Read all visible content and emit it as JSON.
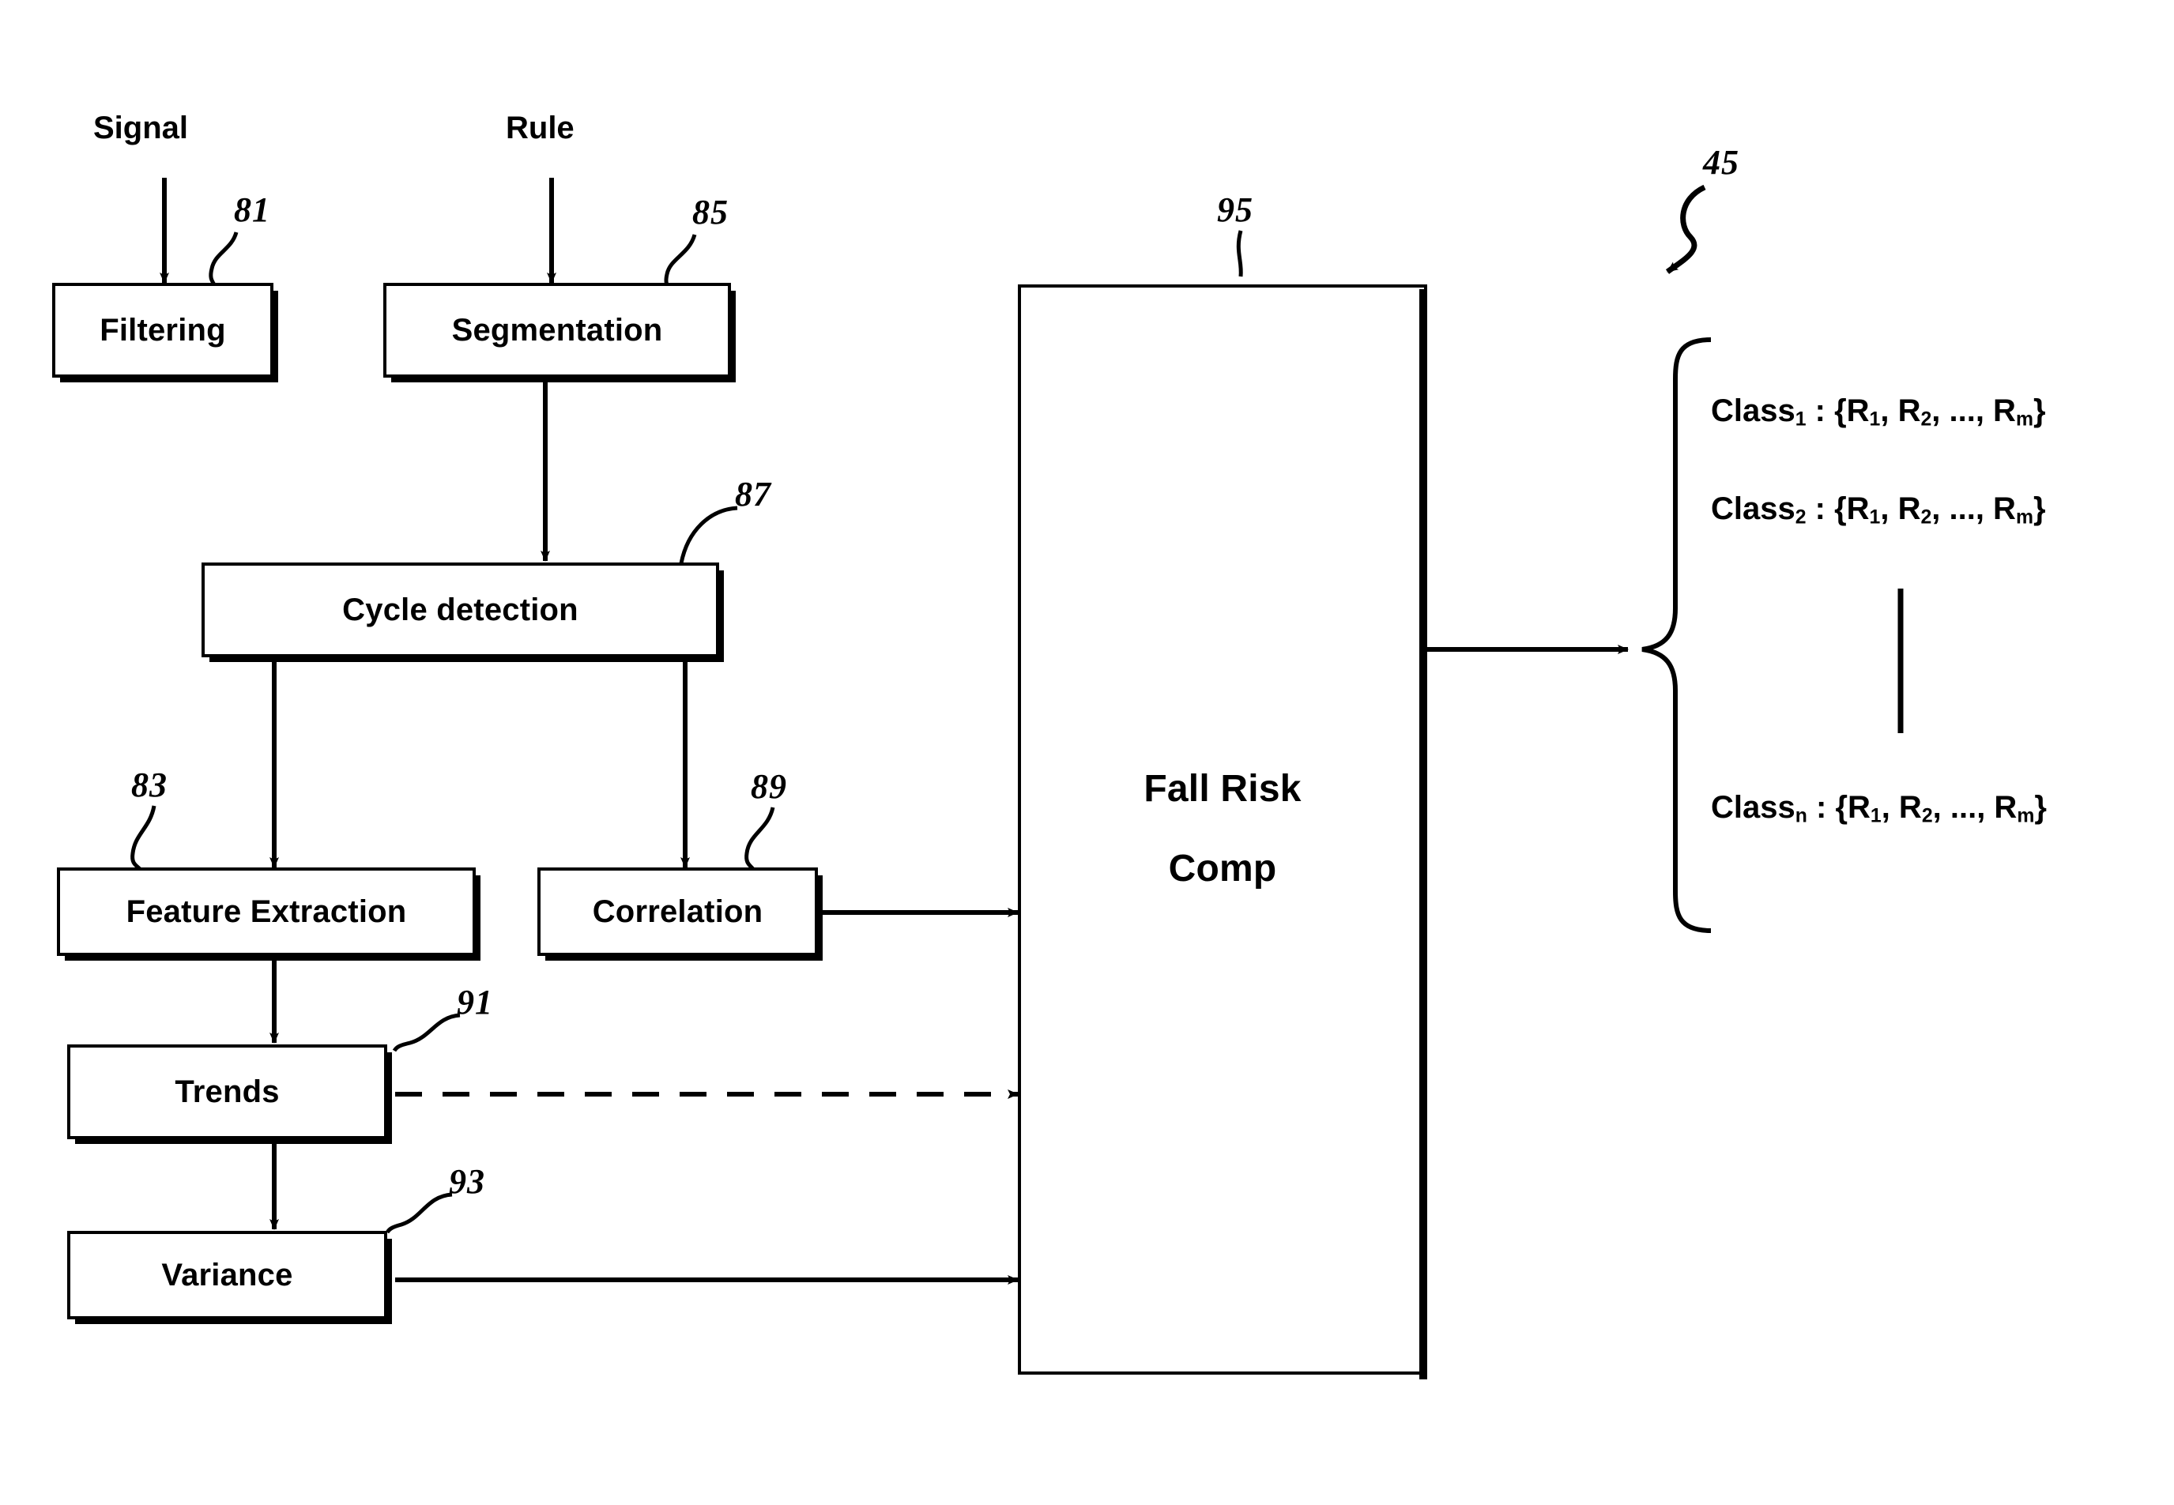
{
  "figure": {
    "number": "45",
    "type": "patent-flow-diagram"
  },
  "inputs": {
    "signal": "Signal",
    "rule": "Rule"
  },
  "nodes": [
    {
      "id": "filtering",
      "label": "Filtering",
      "ref": "81"
    },
    {
      "id": "segmentation",
      "label": "Segmentation",
      "ref": "85"
    },
    {
      "id": "cycle",
      "label": "Cycle detection",
      "ref": "87"
    },
    {
      "id": "feature",
      "label": "Feature Extraction",
      "ref": "83"
    },
    {
      "id": "correlation",
      "label": "Correlation",
      "ref": "89"
    },
    {
      "id": "trends",
      "label": "Trends",
      "ref": "91"
    },
    {
      "id": "variance",
      "label": "Variance",
      "ref": "93"
    },
    {
      "id": "fallrisk",
      "label_line1": "Fall Risk",
      "label_line2": "Comp",
      "ref": "95"
    }
  ],
  "output": {
    "classes": [
      {
        "name": "Class",
        "sub": "1",
        "set": " : {R",
        "s1": "1",
        "c1": ", R",
        "s2": "2",
        "c2": ", ..., R",
        "s3": "m",
        "c3": "}"
      },
      {
        "name": "Class",
        "sub": "2",
        "set": " : {R",
        "s1": "1",
        "c1": ", R",
        "s2": "2",
        "c2": ", ..., R",
        "s3": "m",
        "c3": "}"
      },
      {
        "name": "Class",
        "sub": "n",
        "set": " : {R",
        "s1": "1",
        "c1": ", R",
        "s2": "2",
        "c2": ", ..., R",
        "s3": "m",
        "c3": "}"
      }
    ],
    "ellipsis": "|"
  },
  "colors": {
    "ink": "#000000",
    "paper": "#ffffff"
  }
}
